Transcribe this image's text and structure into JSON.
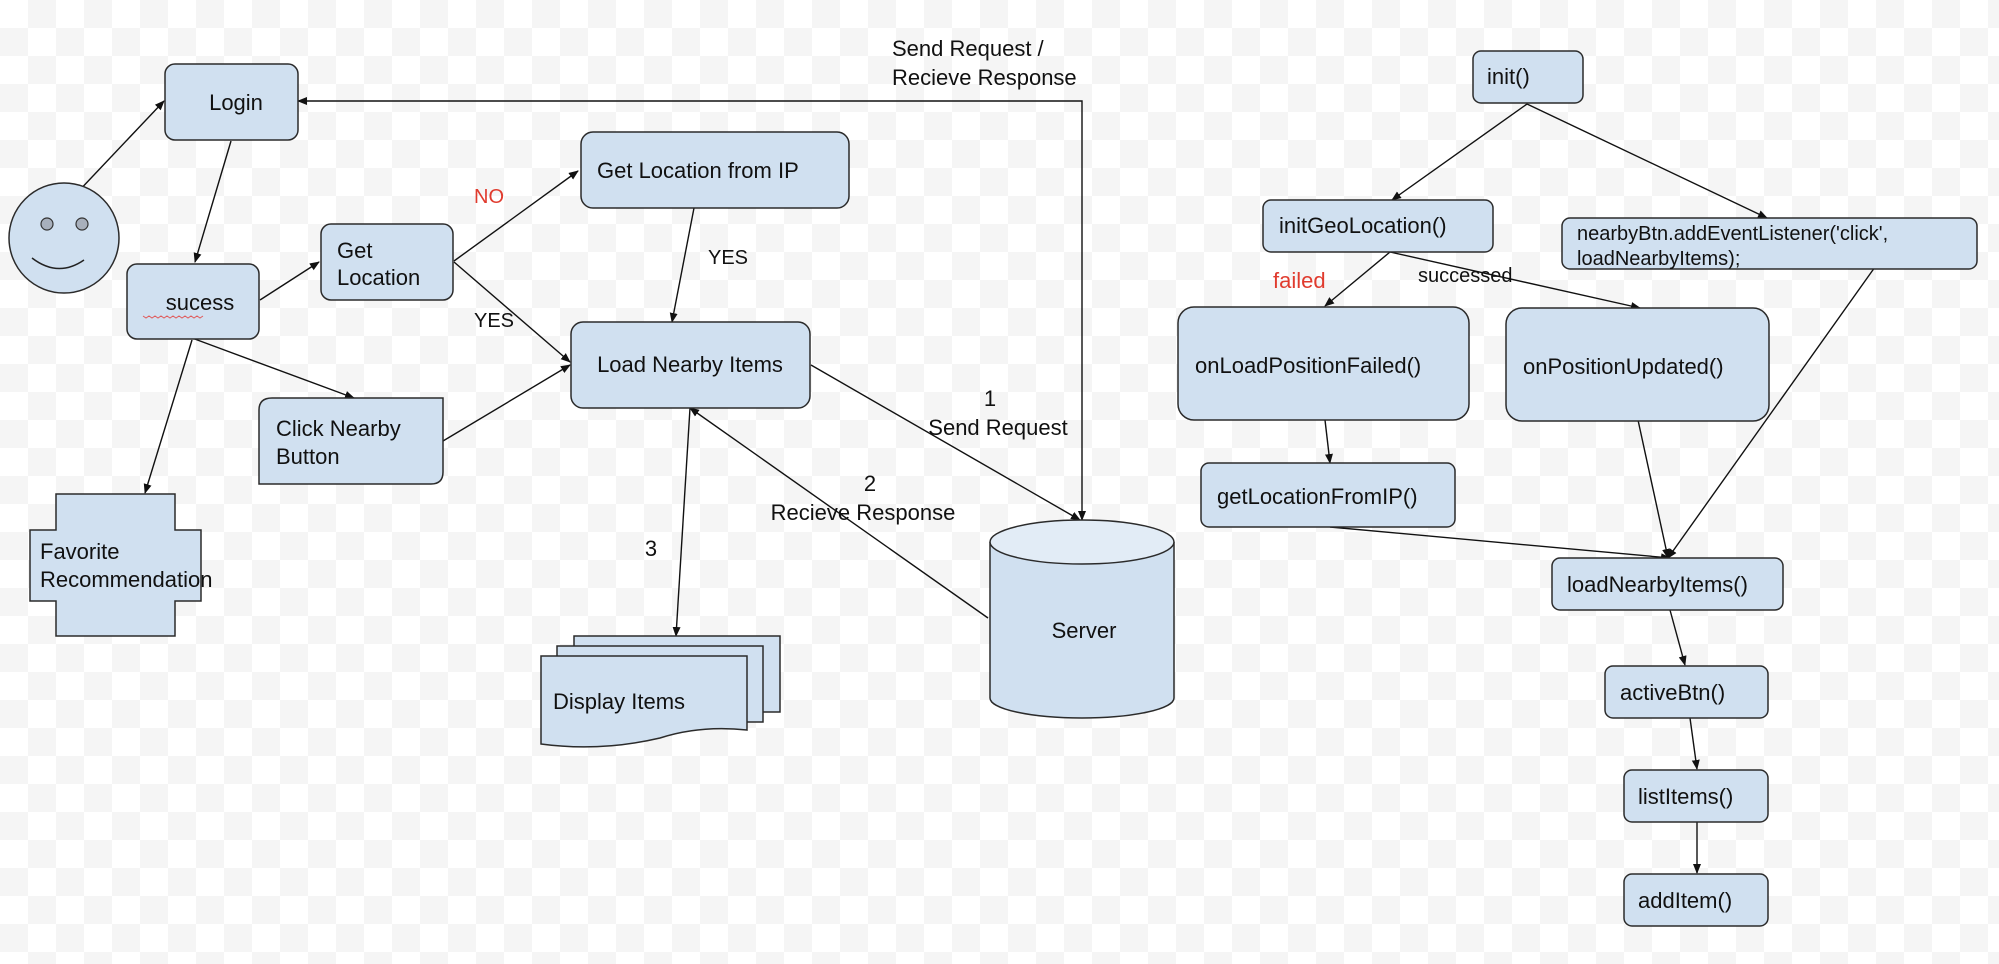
{
  "diagram": {
    "colors": {
      "node_fill": "#d0e0f0",
      "stroke": "#2b2b2b",
      "label_red": "#e03b2e",
      "text": "#111111"
    },
    "nodes": {
      "actor": {
        "label": "",
        "shape": "smiley-face"
      },
      "login": {
        "label": "Login"
      },
      "success": {
        "label": "sucess"
      },
      "get_location": {
        "line1": "Get",
        "line2": "Location"
      },
      "get_location_ip": {
        "label": "Get Location from IP"
      },
      "load_nearby": {
        "label": "Load Nearby Items"
      },
      "click_nearby": {
        "line1": "Click Nearby",
        "line2": "Button"
      },
      "favorite": {
        "line1": "Favorite",
        "line2": "Recommendation"
      },
      "display_items": {
        "label": "Display Items"
      },
      "server": {
        "label": "Server"
      },
      "init": {
        "label": "init()"
      },
      "init_geo": {
        "label": "initGeoLocation()"
      },
      "listener": {
        "line1": "nearbyBtn.addEventListener('click',",
        "line2": "loadNearbyItems);"
      },
      "on_failed": {
        "label": "onLoadPositionFailed()"
      },
      "on_updated": {
        "label": "onPositionUpdated()"
      },
      "get_loc_ip_fn": {
        "label": "getLocationFromIP()"
      },
      "load_nearby_fn": {
        "label": "loadNearbyItems()"
      },
      "active_btn": {
        "label": "activeBtn()"
      },
      "list_items": {
        "label": "listItems()"
      },
      "add_item": {
        "label": "addItem()"
      }
    },
    "edge_labels": {
      "no": "NO",
      "yes_1": "YES",
      "yes_2": "YES",
      "send_recv_line1": "Send Request /",
      "send_recv_line2": "Recieve Response",
      "step1_num": "1",
      "step1_text": "Send Request",
      "step2_num": "2",
      "step2_text": "Recieve Response",
      "step3_num": "3",
      "failed": "failed",
      "successed": "successed"
    }
  }
}
